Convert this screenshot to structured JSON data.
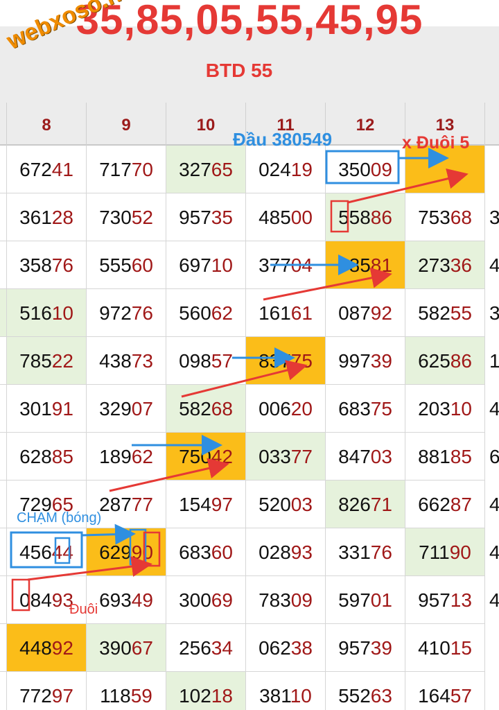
{
  "header": {
    "numbers": "35,85,05,55,45,95",
    "btd": "BTD 55",
    "watermark": "webxoso.net"
  },
  "columns": [
    "8",
    "9",
    "10",
    "11",
    "12",
    "13"
  ],
  "rows": [
    [
      [
        "672",
        "41"
      ],
      [
        "717",
        "70"
      ],
      [
        "327",
        "65"
      ],
      [
        "024",
        "19"
      ],
      [
        "350",
        "09"
      ],
      [
        "",
        ""
      ]
    ],
    [
      [
        "361",
        "28"
      ],
      [
        "730",
        "52"
      ],
      [
        "957",
        "35"
      ],
      [
        "485",
        "00"
      ],
      [
        "558",
        "86"
      ],
      [
        "753",
        "68"
      ]
    ],
    [
      [
        "358",
        "76"
      ],
      [
        "555",
        "60"
      ],
      [
        "697",
        "10"
      ],
      [
        "377",
        "04"
      ],
      [
        "985",
        "81"
      ],
      [
        "273",
        "36"
      ]
    ],
    [
      [
        "516",
        "10"
      ],
      [
        "972",
        "76"
      ],
      [
        "560",
        "62"
      ],
      [
        "161",
        "61"
      ],
      [
        "087",
        "92"
      ],
      [
        "582",
        "55"
      ]
    ],
    [
      [
        "785",
        "22"
      ],
      [
        "438",
        "73"
      ],
      [
        "098",
        "57"
      ],
      [
        "837",
        "75"
      ],
      [
        "997",
        "39"
      ],
      [
        "625",
        "86"
      ]
    ],
    [
      [
        "301",
        "91"
      ],
      [
        "329",
        "07"
      ],
      [
        "582",
        "68"
      ],
      [
        "006",
        "20"
      ],
      [
        "683",
        "75"
      ],
      [
        "203",
        "10"
      ]
    ],
    [
      [
        "628",
        "85"
      ],
      [
        "189",
        "62"
      ],
      [
        "750",
        "42"
      ],
      [
        "033",
        "77"
      ],
      [
        "847",
        "03"
      ],
      [
        "881",
        "85"
      ]
    ],
    [
      [
        "729",
        "65"
      ],
      [
        "287",
        "77"
      ],
      [
        "154",
        "97"
      ],
      [
        "520",
        "03"
      ],
      [
        "826",
        "71"
      ],
      [
        "662",
        "87"
      ]
    ],
    [
      [
        "456",
        "44"
      ],
      [
        "629",
        "90"
      ],
      [
        "683",
        "60"
      ],
      [
        "028",
        "93"
      ],
      [
        "331",
        "76"
      ],
      [
        "711",
        "90"
      ]
    ],
    [
      [
        "084",
        "93"
      ],
      [
        "693",
        "49"
      ],
      [
        "300",
        "69"
      ],
      [
        "783",
        "09"
      ],
      [
        "597",
        "01"
      ],
      [
        "957",
        "13"
      ]
    ],
    [
      [
        "448",
        "92"
      ],
      [
        "390",
        "67"
      ],
      [
        "256",
        "34"
      ],
      [
        "062",
        "38"
      ],
      [
        "957",
        "39"
      ],
      [
        "410",
        "15"
      ]
    ],
    [
      [
        "772",
        "97"
      ],
      [
        "118",
        "59"
      ],
      [
        "102",
        "18"
      ],
      [
        "381",
        "10"
      ],
      [
        "552",
        "63"
      ],
      [
        "164",
        "57"
      ]
    ]
  ],
  "highlights": {
    "green": [
      [
        0,
        2
      ],
      [
        1,
        4
      ],
      [
        2,
        5
      ],
      [
        3,
        0
      ],
      [
        4,
        0
      ],
      [
        4,
        5
      ],
      [
        5,
        2
      ],
      [
        6,
        3
      ],
      [
        7,
        4
      ],
      [
        8,
        5
      ],
      [
        10,
        1
      ],
      [
        11,
        2
      ]
    ],
    "orange": [
      [
        0,
        5
      ],
      [
        2,
        4
      ],
      [
        4,
        3
      ],
      [
        6,
        2
      ],
      [
        8,
        1
      ],
      [
        10,
        0
      ]
    ]
  },
  "right_edge_digits": [
    "3",
    "4",
    "3",
    "1",
    "4",
    "6",
    "4",
    "4",
    "4"
  ],
  "annotations": {
    "dau": "Đầu 380549",
    "duoi5": "x Đuôi 5",
    "cham": "CHẠM (bóng)",
    "duoi": "Đuôi"
  },
  "colors": {
    "title_red": "#e53935",
    "header_text": "#9b1b1b",
    "tail_red": "#a01818",
    "green_cell": "#e6f2dc",
    "orange_cell": "#fbbd19",
    "arrow_blue": "#2f8fe0",
    "arrow_red": "#e53935"
  }
}
